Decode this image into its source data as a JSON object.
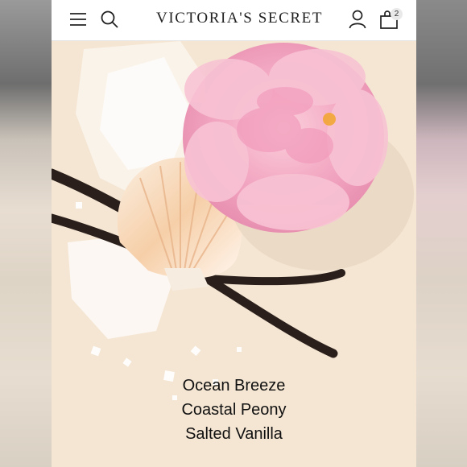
{
  "header": {
    "brand": "Victoria's Secret",
    "bag_count": "2"
  },
  "icons": {
    "menu": "hamburger-menu-icon",
    "search": "search-icon",
    "account": "user-icon",
    "bag": "shopping-bag-icon"
  },
  "scent_notes": [
    "Ocean Breeze",
    "Coastal Peony",
    "Salted Vanilla"
  ],
  "colors": {
    "background": "#f5e6d3",
    "peony": "#f3a9c3",
    "vanilla_pod": "#2a1f1a",
    "text": "#111111"
  }
}
